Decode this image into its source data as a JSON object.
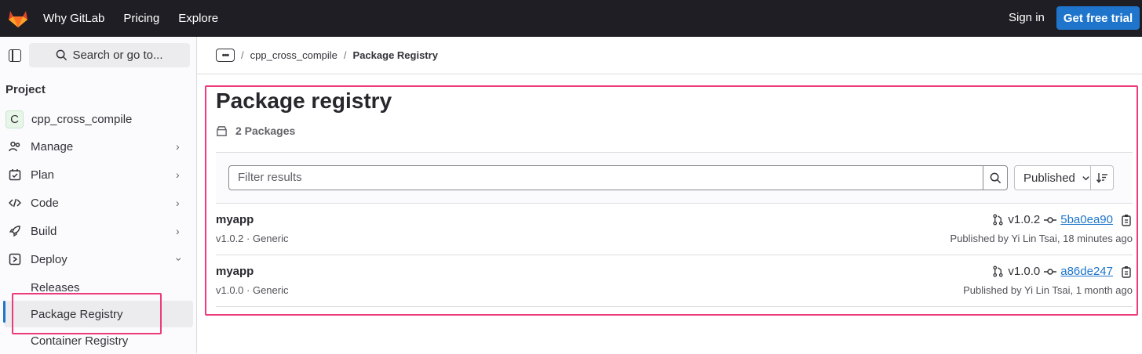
{
  "topbar": {
    "nav": [
      "Why GitLab",
      "Pricing",
      "Explore"
    ],
    "sign_in": "Sign in",
    "trial": "Get free trial"
  },
  "sidebar": {
    "search_label": "Search or go to...",
    "section_title": "Project",
    "project_initial": "C",
    "project_name": "cpp_cross_compile",
    "items": [
      {
        "label": "Manage",
        "icon": "users-icon"
      },
      {
        "label": "Plan",
        "icon": "calendar-icon"
      },
      {
        "label": "Code",
        "icon": "code-icon"
      },
      {
        "label": "Build",
        "icon": "rocket-icon"
      },
      {
        "label": "Deploy",
        "icon": "deploy-icon"
      }
    ],
    "deploy_sub": [
      "Releases",
      "Package Registry",
      "Container Registry"
    ]
  },
  "breadcrumb": {
    "project": "cpp_cross_compile",
    "current": "Package Registry"
  },
  "main": {
    "title": "Package registry",
    "count_label": "2 Packages",
    "filter_placeholder": "Filter results",
    "sort_label": "Published",
    "packages": [
      {
        "name": "myapp",
        "meta": "v1.0.2 · Generic",
        "tag": "v1.0.2",
        "commit": "5ba0ea90",
        "published": "Published by Yi Lin Tsai, 18 minutes ago"
      },
      {
        "name": "myapp",
        "meta": "v1.0.0 · Generic",
        "tag": "v1.0.0",
        "commit": "a86de247",
        "published": "Published by Yi Lin Tsai, 1 month ago"
      }
    ]
  },
  "colors": {
    "topbar": "#1f1e24",
    "accent": "#1f75cb",
    "highlight": "#ec3a7a"
  }
}
